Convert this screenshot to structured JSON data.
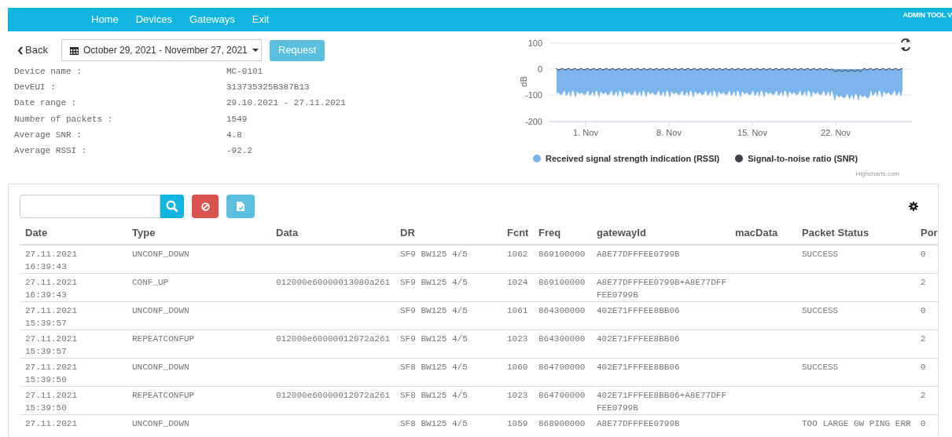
{
  "nav": {
    "links": [
      "Home",
      "Devices",
      "Gateways",
      "Exit"
    ],
    "brand": "ADMIN TOOL V"
  },
  "toolbar": {
    "back": "Back",
    "date_range": "October 29, 2021 - November 27, 2021",
    "request": "Request"
  },
  "info": [
    {
      "label": "Device name :",
      "value": "MC-0101"
    },
    {
      "label": "DevEUI :",
      "value": "313735325B387B13"
    },
    {
      "label": "Date range :",
      "value": "29.10.2021 - 27.11.2021"
    },
    {
      "label": "Number of packets :",
      "value": "1549"
    },
    {
      "label": "Average SNR :",
      "value": "4.8"
    },
    {
      "label": "Average RSSI :",
      "value": "-92.2"
    }
  ],
  "chart": {
    "ylabel": "dB",
    "yticks": [
      "100",
      "0",
      "-100",
      "-200"
    ],
    "xticks": [
      "1. Nov",
      "8. Nov",
      "15. Nov",
      "22. Nov"
    ],
    "legend": [
      {
        "label": "Received signal strength indication (RSSI)",
        "color": "#7cb5ec"
      },
      {
        "label": "Signal-to-noise ratio (SNR)",
        "color": "#434348"
      }
    ],
    "credit": "Highcharts.com"
  },
  "table": {
    "columns": [
      "Date",
      "Type",
      "Data",
      "DR",
      "Fcnt",
      "Freq",
      "gatewayId",
      "macData",
      "Packet Status",
      "Por"
    ],
    "rows": [
      {
        "date": "27.11.2021",
        "time": "16:39:43",
        "type": "UNCONF_DOWN",
        "dr": "SF9 BW125 4/5",
        "fcnt": "1062",
        "freq": "869100000",
        "gateway_id": "A8E77DFFFEE0799B",
        "packet_status": "SUCCESS",
        "port": "0"
      },
      {
        "date": "27.11.2021",
        "time": "16:39:43",
        "type": "CONF_UP",
        "data": "012000e60000013080a261",
        "dr": "SF9 BW125 4/5",
        "fcnt": "1024",
        "freq": "869100000",
        "gateway_id": "A8E77DFFFEE0799B+A8E77DFFFEE0799B",
        "port": "2"
      },
      {
        "date": "27.11.2021",
        "time": "15:39:57",
        "type": "UNCONF_DOWN",
        "dr": "SF9 BW125 4/5",
        "fcnt": "1061",
        "freq": "864300000",
        "gateway_id": "402E71FFFEE8BB06",
        "packet_status": "SUCCESS",
        "port": "0"
      },
      {
        "date": "27.11.2021",
        "time": "15:39:57",
        "type": "REPEATCONFUP",
        "data": "012000e60000012072a261",
        "dr": "SF9 BW125 4/5",
        "fcnt": "1023",
        "freq": "864300000",
        "gateway_id": "402E71FFFEE8BB06",
        "port": "2"
      },
      {
        "date": "27.11.2021",
        "time": "15:39:50",
        "type": "UNCONF_DOWN",
        "dr": "SF8 BW125 4/5",
        "fcnt": "1060",
        "freq": "864700000",
        "gateway_id": "402E71FFFEE8BB06",
        "packet_status": "SUCCESS",
        "port": "0"
      },
      {
        "date": "27.11.2021",
        "time": "15:39:50",
        "type": "REPEATCONFUP",
        "data": "012000e60000012072a261",
        "dr": "SF8 BW125 4/5",
        "fcnt": "1023",
        "freq": "864700000",
        "gateway_id": "402E71FFFEE8BB06+A8E77DFFFEE0799B",
        "port": "2"
      },
      {
        "date": "27.11.2021",
        "type": "UNCONF_DOWN",
        "dr": "SF8 BW125 4/5",
        "fcnt": "1059",
        "freq": "868900000",
        "gateway_id": "A8E77DFFFEE0799B",
        "packet_status": "TOO LARGE GW PING ERR",
        "port": "0"
      }
    ]
  }
}
